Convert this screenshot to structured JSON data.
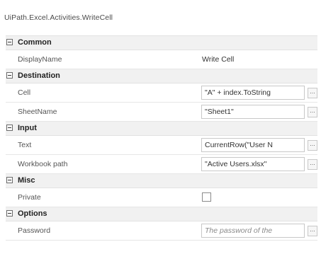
{
  "panel": {
    "title": "UiPath.Excel.Activities.WriteCell"
  },
  "categories": [
    {
      "label": "Common",
      "properties": [
        {
          "name": "DisplayName",
          "value": "Write Cell"
        }
      ]
    },
    {
      "label": "Destination",
      "properties": [
        {
          "name": "Cell",
          "value": "\"A\" + index.ToString"
        },
        {
          "name": "SheetName",
          "value": "\"Sheet1\""
        }
      ]
    },
    {
      "label": "Input",
      "properties": [
        {
          "name": "Text",
          "value": "CurrentRow(\"User N"
        },
        {
          "name": "Workbook path",
          "value": "\"Active Users.xlsx\""
        }
      ]
    },
    {
      "label": "Misc",
      "properties": [
        {
          "name": "Private",
          "checked": false
        }
      ]
    },
    {
      "label": "Options",
      "properties": [
        {
          "name": "Password",
          "placeholder": "The password of the"
        }
      ]
    }
  ],
  "ellipsis_label": "..."
}
